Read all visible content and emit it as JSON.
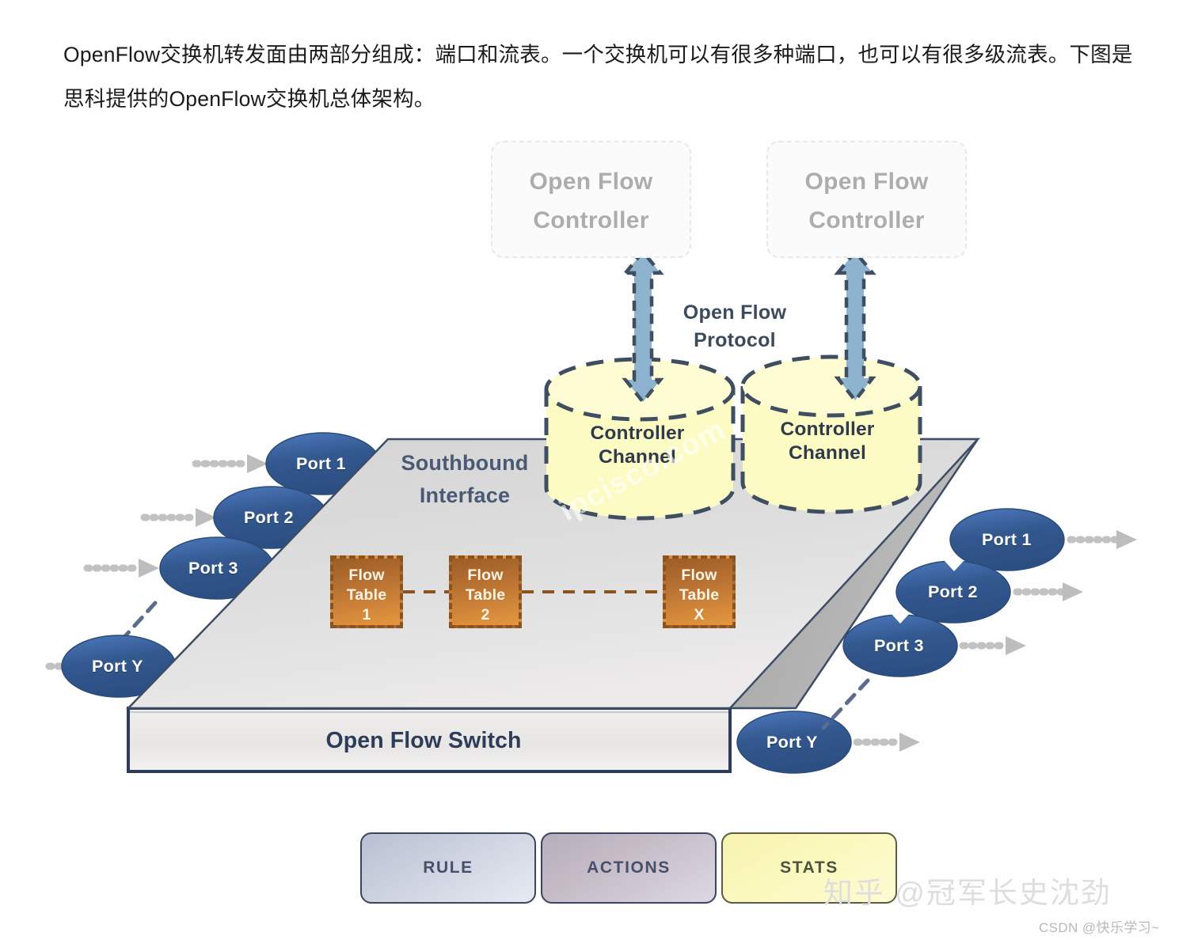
{
  "article": {
    "paragraph": "OpenFlow交换机转发面由两部分组成：端口和流表。一个交换机可以有很多种端口，也可以有很多级流表。下图是思科提供的OpenFlow交换机总体架构。"
  },
  "figure": {
    "controllers": [
      {
        "label": "Open Flow\nController",
        "line1": "Open Flow",
        "line2": "Controller"
      },
      {
        "label": "Open Flow\nController",
        "line1": "Open Flow",
        "line2": "Controller"
      }
    ],
    "protocol_label": "Open Flow\nProtocol",
    "protocol_line1": "Open Flow",
    "protocol_line2": "Protocol",
    "channels": [
      {
        "line1": "Controller",
        "line2": "Channel"
      },
      {
        "line1": "Controller",
        "line2": "Channel"
      }
    ],
    "southbound_line1": "Southbound",
    "southbound_line2": "Interface",
    "flow_tables": [
      {
        "line1": "Flow",
        "line2": "Table",
        "line3": "1"
      },
      {
        "line1": "Flow",
        "line2": "Table",
        "line3": "2"
      },
      {
        "line1": "Flow",
        "line2": "Table",
        "line3": "X"
      }
    ],
    "switch_label": "Open Flow Switch",
    "ingress_ports": [
      {
        "label": "Port 1"
      },
      {
        "label": "Port 2"
      },
      {
        "label": "Port 3"
      },
      {
        "label": "Port Y"
      }
    ],
    "egress_ports": [
      {
        "label": "Port 1"
      },
      {
        "label": "Port 2"
      },
      {
        "label": "Port 3"
      },
      {
        "label": "Port Y"
      }
    ],
    "flow_entry_boxes": [
      {
        "label": "RULE"
      },
      {
        "label": "ACTIONS"
      },
      {
        "label": "STATS"
      }
    ],
    "watermarks": {
      "source": "ipcisco.com",
      "zhihu": "知乎 @冠军长史沈劲",
      "csdn": "CSDN @快乐学习~"
    },
    "colors": {
      "port_fill": "#2f5597",
      "port_fill_light": "#4a74b8",
      "slab_top": "#d9d9d9",
      "slab_side": "#a6a6a6",
      "slab_outline": "#2d3d59",
      "cylinder_fill": "#fcfbc4",
      "cylinder_stroke": "#3f4e60",
      "arrow_blue": "#8db3cf",
      "flow_table_fill": "#c2762f",
      "flow_table_stroke": "#8a5420",
      "dotted_arrow": "#bfbfbf",
      "rule_fill": "#ced3e0",
      "actions_fill": "#c5bcc6",
      "stats_fill": "#fbf8bd"
    }
  }
}
